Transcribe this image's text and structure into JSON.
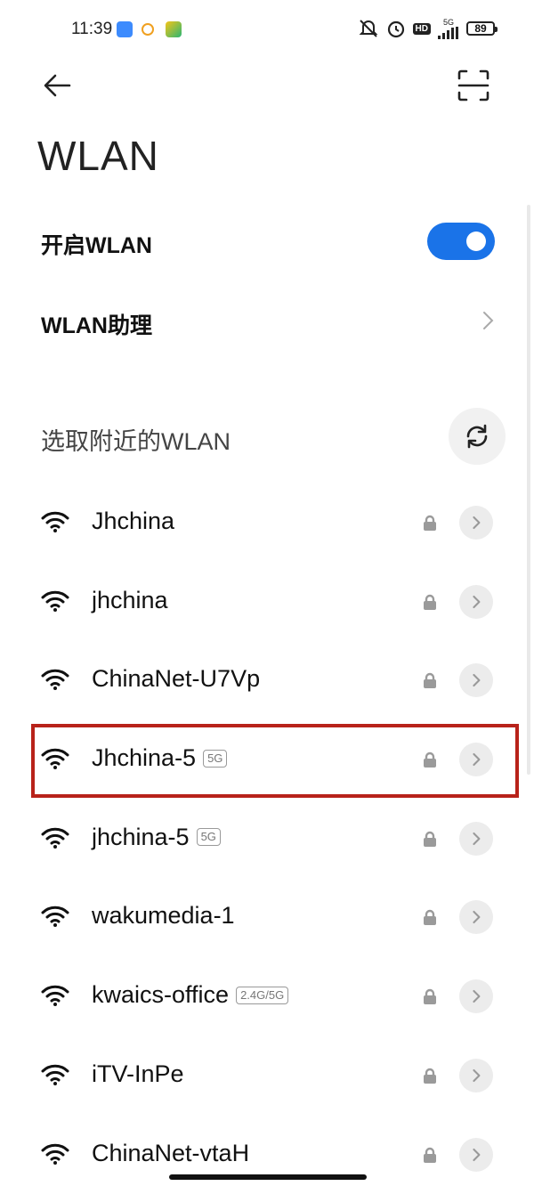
{
  "status_bar": {
    "time": "11:39",
    "network_type": "5G",
    "hd_label": "HD",
    "battery": "89",
    "icons": [
      "feishu-icon",
      "app-notif-icon",
      "video-app-icon",
      "mute-icon",
      "alarm-icon",
      "hd-icon",
      "signal-icon",
      "battery-icon"
    ]
  },
  "header": {
    "back_icon": "arrow-left-icon",
    "scan_icon": "qr-scan-icon",
    "title": "WLAN"
  },
  "settings": {
    "enable_wlan_label": "开启WLAN",
    "enable_wlan_on": true,
    "assistant_label": "WLAN助理"
  },
  "nearby": {
    "section_label": "选取附近的WLAN",
    "networks": [
      {
        "name": "Jhchina",
        "badge": "",
        "secured": true
      },
      {
        "name": "jhchina",
        "badge": "",
        "secured": true
      },
      {
        "name": "ChinaNet-U7Vp",
        "badge": "",
        "secured": true
      },
      {
        "name": "Jhchina-5",
        "badge": "5G",
        "secured": true,
        "highlighted": true
      },
      {
        "name": "jhchina-5",
        "badge": "5G",
        "secured": true
      },
      {
        "name": "wakumedia-1",
        "badge": "",
        "secured": true
      },
      {
        "name": "kwaics-office",
        "badge": "2.4G/5G",
        "secured": true
      },
      {
        "name": "iTV-InPe",
        "badge": "",
        "secured": true
      },
      {
        "name": "ChinaNet-vtaH",
        "badge": "",
        "secured": true
      }
    ]
  },
  "colors": {
    "toggle_on": "#1a73e8",
    "highlight": "#b8221a"
  }
}
